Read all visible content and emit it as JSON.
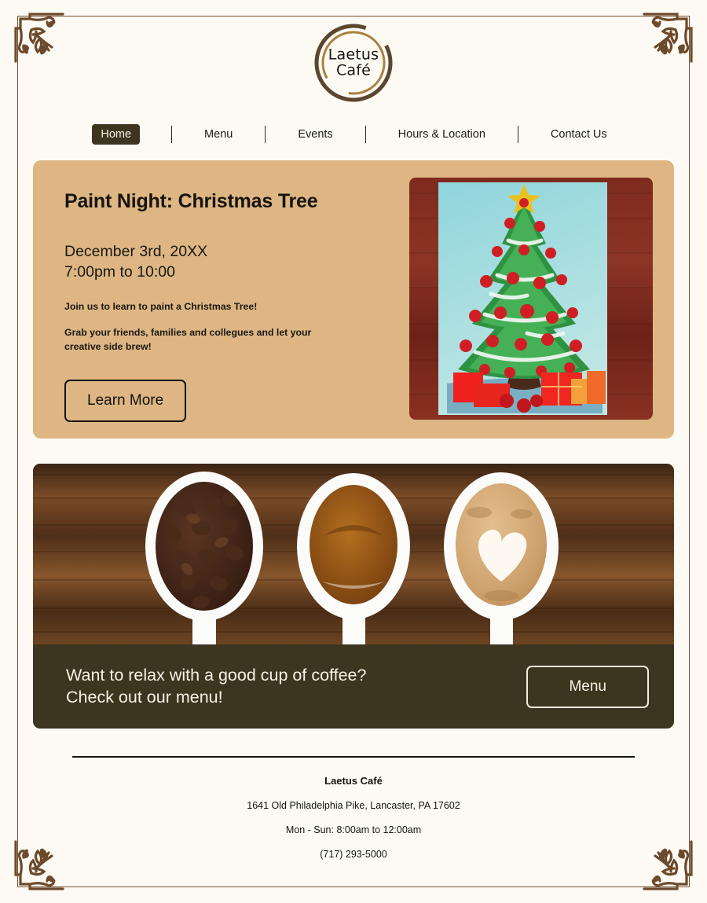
{
  "brand": {
    "logo_line1": "Laetus",
    "logo_line2": "Café",
    "ring_outer_color": "#5b4630",
    "ring_inner_color": "#a8803c"
  },
  "nav": {
    "items": [
      {
        "label": "Home",
        "active": true
      },
      {
        "label": "Menu",
        "active": false
      },
      {
        "label": "Events",
        "active": false
      },
      {
        "label": "Hours & Location",
        "active": false
      },
      {
        "label": "Contact Us",
        "active": false
      }
    ],
    "active_bg": "#3d3520",
    "active_fg": "#f7f2e6"
  },
  "hero": {
    "bg_color": "#ddb684",
    "title": "Paint Night: Christmas Tree",
    "date": "December 3rd, 20XX",
    "time": "7:00pm to 10:00",
    "paragraph1": "Join us to learn to paint a Christmas Tree!",
    "paragraph2": "Grab your friends, families and collegues and let your creative side brew!",
    "button_label": "Learn More",
    "image_alt": "christmas-tree-painting"
  },
  "promo": {
    "bar_color": "#3d3520",
    "headline_line1": "Want to relax with a good cup of coffee?",
    "headline_line2": "Check out our menu!",
    "button_label": "Menu",
    "image_alt": "three-spoons-coffee-beans-espresso-latte"
  },
  "footer": {
    "name": "Laetus Café",
    "address": "1641 Old Philadelphia Pike, Lancaster, PA 17602",
    "hours": "Mon - Sun: 8:00am to 12:00am",
    "phone": "(717) 293-5000"
  },
  "theme": {
    "page_bg": "#fdfaf4",
    "frame_color": "#7a5230",
    "ink": "#17140f"
  }
}
